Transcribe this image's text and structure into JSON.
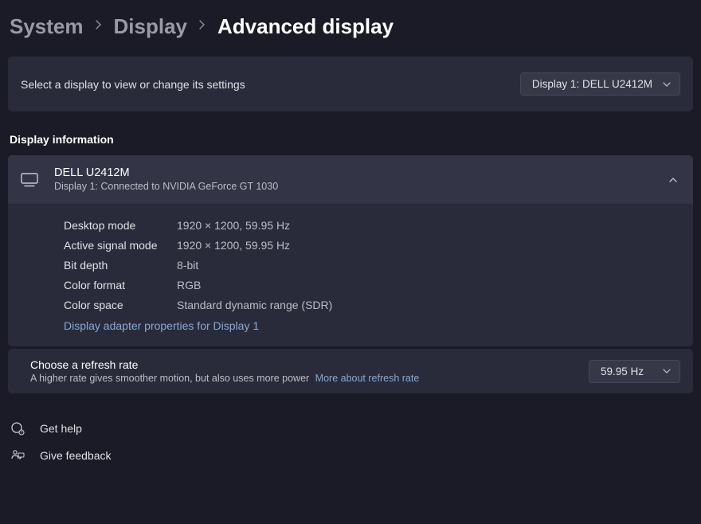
{
  "breadcrumb": {
    "system": "System",
    "display": "Display",
    "advanced": "Advanced display"
  },
  "selectDisplay": {
    "prompt": "Select a display to view or change its settings",
    "selected": "Display 1: DELL U2412M"
  },
  "sectionTitle": "Display information",
  "displayHeader": {
    "name": "DELL U2412M",
    "sub": "Display 1: Connected to NVIDIA GeForce GT 1030"
  },
  "info": {
    "desktopModeLabel": "Desktop mode",
    "desktopModeValue": "1920 × 1200, 59.95 Hz",
    "activeSignalLabel": "Active signal mode",
    "activeSignalValue": "1920 × 1200, 59.95 Hz",
    "bitDepthLabel": "Bit depth",
    "bitDepthValue": "8-bit",
    "colorFormatLabel": "Color format",
    "colorFormatValue": "RGB",
    "colorSpaceLabel": "Color space",
    "colorSpaceValue": "Standard dynamic range (SDR)",
    "adapterLink": "Display adapter properties for Display 1"
  },
  "refresh": {
    "title": "Choose a refresh rate",
    "sub": "A higher rate gives smoother motion, but also uses more power",
    "moreLink": "More about refresh rate",
    "selected": "59.95 Hz"
  },
  "footer": {
    "help": "Get help",
    "feedback": "Give feedback"
  }
}
